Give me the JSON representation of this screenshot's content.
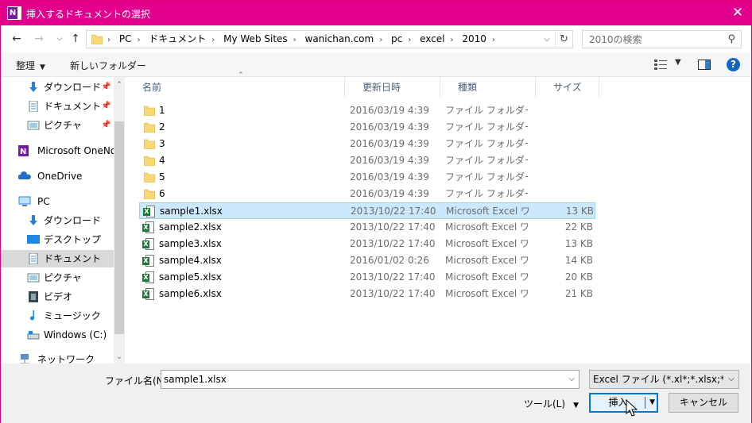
{
  "window": {
    "title": "挿入するドキュメントの選択",
    "app_icon_letter": "N",
    "close_glyph": "✕",
    "accent_color": "#e3008c"
  },
  "address": {
    "crumbs": [
      "PC",
      "ドキュメント",
      "My Web Sites",
      "wanichan.com",
      "pc",
      "excel",
      "2010"
    ],
    "search_placeholder": "2010の検索"
  },
  "toolbar": {
    "organize_label": "整理",
    "new_folder_label": "新しいフォルダー",
    "help_label": "?"
  },
  "sidebar": {
    "items": [
      {
        "label": "ダウンロード",
        "icon": "download-arrow-icon",
        "pinned": true
      },
      {
        "label": "ドキュメント",
        "icon": "document-icon",
        "pinned": true
      },
      {
        "label": "ピクチャ",
        "icon": "pictures-icon",
        "pinned": true
      },
      {
        "label": "Microsoft OneNote",
        "icon": "onenote-icon",
        "pinned": false
      },
      {
        "label": "OneDrive",
        "icon": "onedrive-icon",
        "pinned": false
      },
      {
        "label": "PC",
        "icon": "pc-icon",
        "pinned": false
      },
      {
        "label": "ダウンロード",
        "icon": "download-arrow-icon",
        "pinned": false
      },
      {
        "label": "デスクトップ",
        "icon": "desktop-icon",
        "pinned": false
      },
      {
        "label": "ドキュメント",
        "icon": "document-icon",
        "pinned": false,
        "selected": true
      },
      {
        "label": "ピクチャ",
        "icon": "pictures-icon",
        "pinned": false
      },
      {
        "label": "ビデオ",
        "icon": "video-icon",
        "pinned": false
      },
      {
        "label": "ミュージック",
        "icon": "music-icon",
        "pinned": false
      },
      {
        "label": "Windows (C:)",
        "icon": "drive-icon",
        "pinned": false
      },
      {
        "label": "ネットワーク",
        "icon": "network-icon",
        "pinned": false
      }
    ]
  },
  "filelist": {
    "columns": [
      "名前",
      "更新日時",
      "種類",
      "サイズ"
    ],
    "rows": [
      {
        "name": "1",
        "date": "2016/03/19 4:39",
        "type": "ファイル フォルダー",
        "size": "",
        "kind": "folder"
      },
      {
        "name": "2",
        "date": "2016/03/19 4:39",
        "type": "ファイル フォルダー",
        "size": "",
        "kind": "folder"
      },
      {
        "name": "3",
        "date": "2016/03/19 4:39",
        "type": "ファイル フォルダー",
        "size": "",
        "kind": "folder"
      },
      {
        "name": "4",
        "date": "2016/03/19 4:39",
        "type": "ファイル フォルダー",
        "size": "",
        "kind": "folder"
      },
      {
        "name": "5",
        "date": "2016/03/19 4:39",
        "type": "ファイル フォルダー",
        "size": "",
        "kind": "folder"
      },
      {
        "name": "6",
        "date": "2016/03/19 4:39",
        "type": "ファイル フォルダー",
        "size": "",
        "kind": "folder"
      },
      {
        "name": "sample1.xlsx",
        "date": "2013/10/22 17:40",
        "type": "Microsoft Excel ワ...",
        "size": "13 KB",
        "kind": "excel",
        "selected": true
      },
      {
        "name": "sample2.xlsx",
        "date": "2013/10/22 17:40",
        "type": "Microsoft Excel ワ...",
        "size": "22 KB",
        "kind": "excel"
      },
      {
        "name": "sample3.xlsx",
        "date": "2013/10/22 17:40",
        "type": "Microsoft Excel ワ...",
        "size": "13 KB",
        "kind": "excel"
      },
      {
        "name": "sample4.xlsx",
        "date": "2016/01/02 0:26",
        "type": "Microsoft Excel ワ...",
        "size": "14 KB",
        "kind": "excel"
      },
      {
        "name": "sample5.xlsx",
        "date": "2013/10/22 17:40",
        "type": "Microsoft Excel ワ...",
        "size": "20 KB",
        "kind": "excel"
      },
      {
        "name": "sample6.xlsx",
        "date": "2013/10/22 17:40",
        "type": "Microsoft Excel ワ...",
        "size": "21 KB",
        "kind": "excel"
      }
    ]
  },
  "footer": {
    "filename_label": "ファイル名(N):",
    "filename_value": "sample1.xlsx",
    "filetype_value": "Excel ファイル (*.xl*;*.xlsx;*.xlsm;*",
    "tools_label": "ツール(L)",
    "insert_label": "挿入",
    "cancel_label": "キャンセル"
  }
}
